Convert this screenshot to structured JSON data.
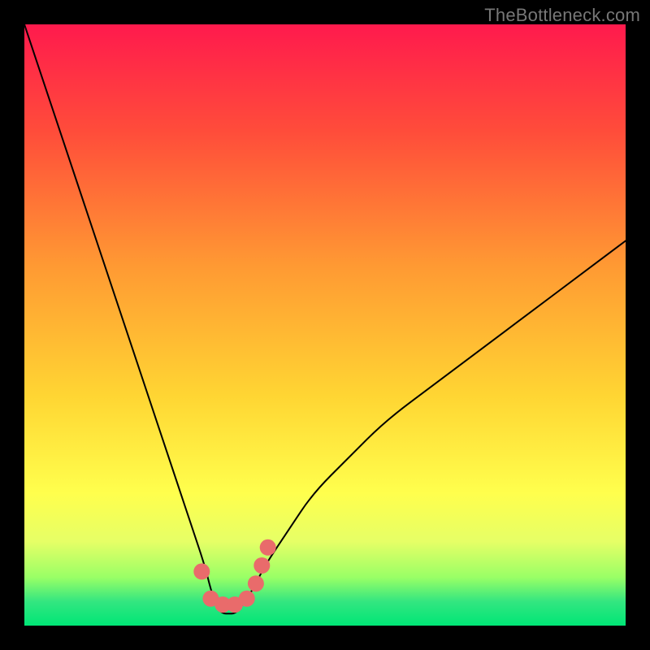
{
  "watermark": "TheBottleneck.com",
  "chart_data": {
    "type": "line",
    "title": "",
    "xlabel": "",
    "ylabel": "",
    "xlim": [
      0,
      100
    ],
    "ylim": [
      0,
      100
    ],
    "background_gradient": {
      "top_color": "#ff1a4d",
      "mid_color": "#ffe600",
      "bottom_color": "#00e676",
      "notes": "vertical rainbow gradient red→orange→yellow→green"
    },
    "series": [
      {
        "name": "bottleneck-curve",
        "x": [
          0,
          4,
          8,
          12,
          16,
          20,
          24,
          26,
          28,
          30,
          31,
          32,
          33,
          34,
          35,
          36,
          38,
          40,
          44,
          48,
          54,
          60,
          68,
          76,
          84,
          92,
          100
        ],
        "y": [
          100,
          88,
          76,
          64,
          52,
          40,
          28,
          22,
          16,
          10,
          6,
          3,
          2,
          2,
          2,
          3,
          6,
          10,
          16,
          22,
          28,
          34,
          40,
          46,
          52,
          58,
          64
        ],
        "color": "#000000",
        "notes": "V-shaped curve; left branch steep, right branch shallower; minimum near x=33 at y≈2"
      }
    ],
    "markers": [
      {
        "name": "trough-dots",
        "x": [
          29.5,
          31,
          33,
          35,
          37,
          38.5,
          39.5,
          40.5
        ],
        "y": [
          9,
          4.5,
          3.5,
          3.5,
          4.5,
          7,
          10,
          13
        ],
        "color": "#e96b6b",
        "radius_px": 10,
        "notes": "salmon-pink chunky dots forming a small U at the curve trough"
      }
    ]
  }
}
